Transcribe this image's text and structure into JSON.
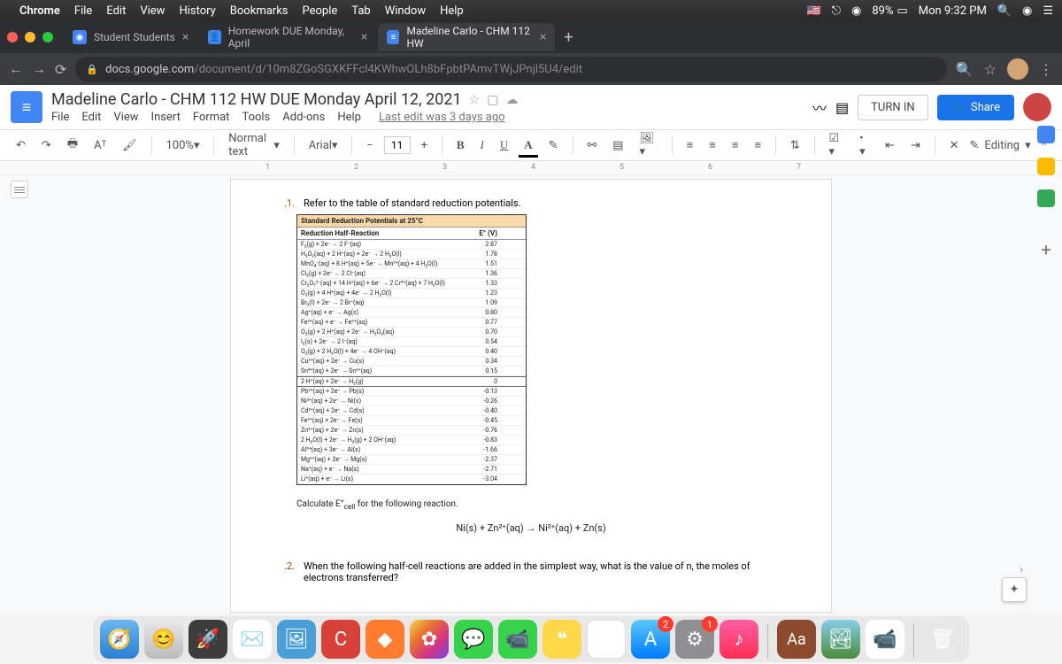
{
  "mac_menu": {
    "app": "Chrome",
    "items": [
      "File",
      "Edit",
      "View",
      "History",
      "Bookmarks",
      "People",
      "Tab",
      "Window",
      "Help"
    ],
    "battery": "89%",
    "clock": "Mon 9:32 PM"
  },
  "tabs": [
    {
      "label": "Student Students",
      "active": false
    },
    {
      "label": "Homework DUE Monday, April",
      "active": false
    },
    {
      "label": "Madeline Carlo - CHM 112 HW",
      "active": true
    }
  ],
  "url": {
    "domain": "docs.google.com",
    "path": "/document/d/10m8ZGoSGXKFFcl4KWhwOLh8bFpbtPAmvTWjJPnjl5U4/edit"
  },
  "docs": {
    "title": "Madeline Carlo - CHM 112 HW DUE Monday April 12, 2021",
    "menus": [
      "File",
      "Edit",
      "View",
      "Insert",
      "Format",
      "Tools",
      "Add-ons",
      "Help"
    ],
    "last_edit": "Last edit was 3 days ago",
    "turn_in": "TURN IN",
    "share": "Share",
    "zoom": "100%",
    "style": "Normal text",
    "font": "Arial",
    "font_size": "11",
    "editing": "Editing"
  },
  "ruler_marks": [
    "1",
    "2",
    "3",
    "4",
    "5",
    "6",
    "7"
  ],
  "document": {
    "q1_num": ".1.",
    "q1_text": "Refer to the table of standard reduction potentials.",
    "table_title": "Standard Reduction Potentials at 25°C",
    "col1": "Reduction Half-Reaction",
    "col2": "E° (V)",
    "rows": [
      {
        "r": "F₂(g) + 2e⁻ → 2 F⁻(aq)",
        "v": "2.87"
      },
      {
        "r": "H₂O₂(aq) + 2 H⁺(aq) + 2e⁻ → 2 H₂O(l)",
        "v": "1.78"
      },
      {
        "r": "MnO₄⁻(aq) + 8 H⁺(aq) + 5e⁻ → Mn²⁺(aq) + 4 H₂O(l)",
        "v": "1.51"
      },
      {
        "r": "Cl₂(g) + 2e⁻ → 2 Cl⁻(aq)",
        "v": "1.36"
      },
      {
        "r": "Cr₂O₇²⁻(aq) + 14 H⁺(aq) + 6e⁻ → 2 Cr³⁺(aq) + 7 H₂O(l)",
        "v": "1.33"
      },
      {
        "r": "O₂(g) + 4 H⁺(aq) + 4e⁻ → 2 H₂O(l)",
        "v": "1.23"
      },
      {
        "r": "Br₂(l) + 2e⁻ → 2 Br⁻(aq)",
        "v": "1.09"
      },
      {
        "r": "Ag⁺(aq) + e⁻ → Ag(s)",
        "v": "0.80"
      },
      {
        "r": "Fe³⁺(aq) + e⁻ → Fe²⁺(aq)",
        "v": "0.77"
      },
      {
        "r": "O₂(g) + 2 H⁺(aq) + 2e⁻ → H₂O₂(aq)",
        "v": "0.70"
      },
      {
        "r": "I₂(s) + 2e⁻ → 2 I⁻(aq)",
        "v": "0.54"
      },
      {
        "r": "O₂(g) + 2 H₂O(l) + 4e⁻ → 4 OH⁻(aq)",
        "v": "0.40"
      },
      {
        "r": "Cu²⁺(aq) + 2e⁻ → Cu(s)",
        "v": "0.34"
      },
      {
        "r": "Sn⁴⁺(aq) + 2e⁻ → Sn²⁺(aq)",
        "v": "0.15"
      },
      {
        "r": "2 H⁺(aq) + 2e⁻ → H₂(g)",
        "v": "0",
        "zero": true
      },
      {
        "r": "Pb²⁺(aq) + 2e⁻ → Pb(s)",
        "v": "-0.13"
      },
      {
        "r": "Ni²⁺(aq) + 2e⁻ → Ni(s)",
        "v": "-0.26"
      },
      {
        "r": "Cd²⁺(aq) + 2e⁻ → Cd(s)",
        "v": "-0.40"
      },
      {
        "r": "Fe²⁺(aq) + 2e⁻ → Fe(s)",
        "v": "-0.45"
      },
      {
        "r": "Zn²⁺(aq) + 2e⁻ → Zn(s)",
        "v": "-0.76"
      },
      {
        "r": "2 H₂O(l) + 2e⁻ → H₂(g) + 2 OH⁻(aq)",
        "v": "-0.83"
      },
      {
        "r": "Al³⁺(aq) + 3e⁻ → Al(s)",
        "v": "-1.66"
      },
      {
        "r": "Mg²⁺(aq) + 2e⁻ → Mg(s)",
        "v": "-2.37"
      },
      {
        "r": "Na⁺(aq) + e⁻ → Na(s)",
        "v": "-2.71"
      },
      {
        "r": "Li⁺(aq) + e⁻ → Li(s)",
        "v": "-3.04"
      }
    ],
    "calc_label": "Calculate E°",
    "calc_sub": "cell",
    "calc_rest": " for the following reaction.",
    "reaction": "Ni(s) + Zn²⁺(aq) → Ni²⁺(aq) + Zn(s)",
    "q2_num": ".2.",
    "q2_text": "When the following half-cell reactions are added in the simplest way, what is the value of n, the moles of electrons transferred?"
  },
  "dock_badges": {
    "appstore": "2",
    "settings": "1"
  },
  "dict_label": "Aa"
}
